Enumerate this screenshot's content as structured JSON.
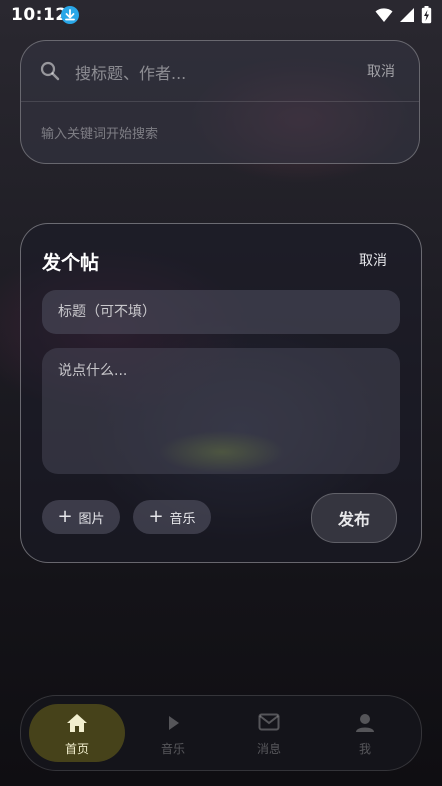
{
  "status_bar": {
    "time": "10:12",
    "icons": [
      "download-icon",
      "wifi-icon",
      "signal-icon",
      "battery-charging-icon"
    ]
  },
  "search": {
    "placeholder": "搜标题、作者...",
    "value": "",
    "cancel_label": "取消",
    "hint": "输入关键词开始搜索"
  },
  "post": {
    "title": "发个帖",
    "cancel_label": "取消",
    "title_placeholder": "标题（可不填）",
    "body_placeholder": "说点什么...",
    "add_image_label": "图片",
    "add_music_label": "音乐",
    "publish_label": "发布"
  },
  "nav": {
    "items": [
      {
        "label": "首页",
        "icon": "home-icon",
        "active": true
      },
      {
        "label": "音乐",
        "icon": "play-icon",
        "active": false
      },
      {
        "label": "消息",
        "icon": "mail-icon",
        "active": false
      },
      {
        "label": "我",
        "icon": "person-icon",
        "active": false
      }
    ]
  },
  "colors": {
    "accent_active_nav": "#70681c",
    "download_badge": "#29a7e8"
  }
}
